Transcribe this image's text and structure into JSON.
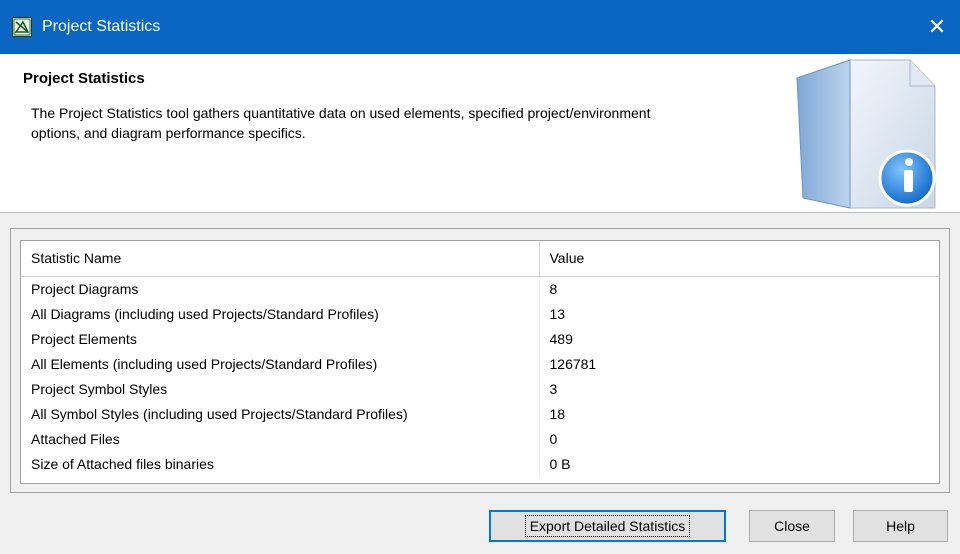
{
  "window": {
    "title": "Project Statistics",
    "icon": "app-icon",
    "close_icon": "close-icon",
    "close_glyph": "✕"
  },
  "header": {
    "title": "Project Statistics",
    "description": "The Project Statistics tool gathers quantitative data on used elements, specified project/environment options, and diagram performance specifics.",
    "graphic": "document-info-icon"
  },
  "table": {
    "columns": [
      "Statistic Name",
      "Value"
    ],
    "rows": [
      {
        "name": "Project Diagrams",
        "value": "8"
      },
      {
        "name": "All Diagrams (including used Projects/Standard Profiles)",
        "value": "13"
      },
      {
        "name": "Project Elements",
        "value": "489"
      },
      {
        "name": "All Elements (including used Projects/Standard Profiles)",
        "value": "126781"
      },
      {
        "name": "Project Symbol Styles",
        "value": "3"
      },
      {
        "name": "All Symbol Styles (including used Projects/Standard Profiles)",
        "value": "18"
      },
      {
        "name": "Attached Files",
        "value": "0"
      },
      {
        "name": "Size of Attached files binaries",
        "value": "0 B"
      }
    ]
  },
  "buttons": {
    "export": "Export Detailed Statistics",
    "close": "Close",
    "help": "Help"
  },
  "colors": {
    "titlebar": "#0a66c2",
    "accent": "#0078d7"
  }
}
